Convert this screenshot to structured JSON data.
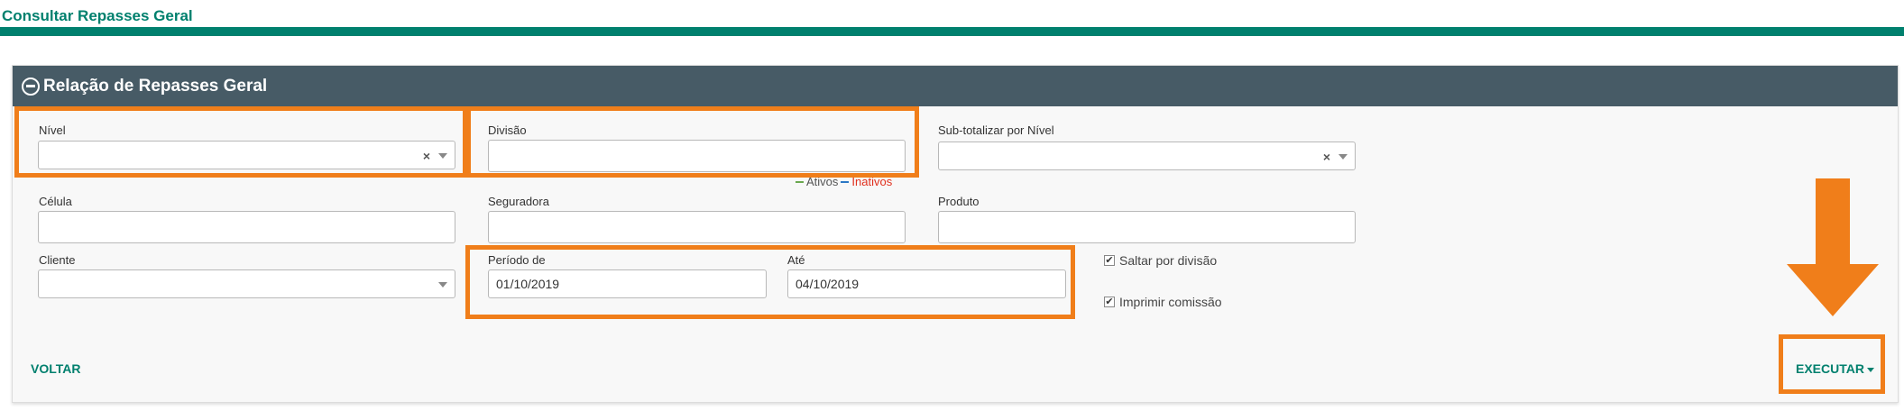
{
  "page": {
    "title": "Consultar Repasses Geral"
  },
  "panel": {
    "title": "Relação de Repasses Geral"
  },
  "form": {
    "nivel": {
      "label": "Nível",
      "value": ""
    },
    "divisao": {
      "label": "Divisão",
      "value": ""
    },
    "subtotal": {
      "label": "Sub-totalizar por Nível",
      "value": ""
    },
    "legend": {
      "ativos": "Ativos",
      "inativos": "Inativos"
    },
    "celula": {
      "label": "Célula",
      "value": ""
    },
    "seguradora": {
      "label": "Seguradora",
      "value": ""
    },
    "produto": {
      "label": "Produto",
      "value": ""
    },
    "cliente": {
      "label": "Cliente",
      "value": ""
    },
    "periodo_de": {
      "label": "Período de",
      "value": "01/10/2019"
    },
    "ate": {
      "label": "Até",
      "value": "04/10/2019"
    },
    "saltar": {
      "label": "Saltar por divisão",
      "checked": true
    },
    "imprimir": {
      "label": "Imprimir comissão",
      "checked": true
    },
    "clear_glyph": "×"
  },
  "actions": {
    "voltar": "VOLTAR",
    "executar": "EXECUTAR"
  },
  "colors": {
    "brand": "#00806e",
    "header": "#475b66",
    "highlight": "#f07e1a"
  }
}
